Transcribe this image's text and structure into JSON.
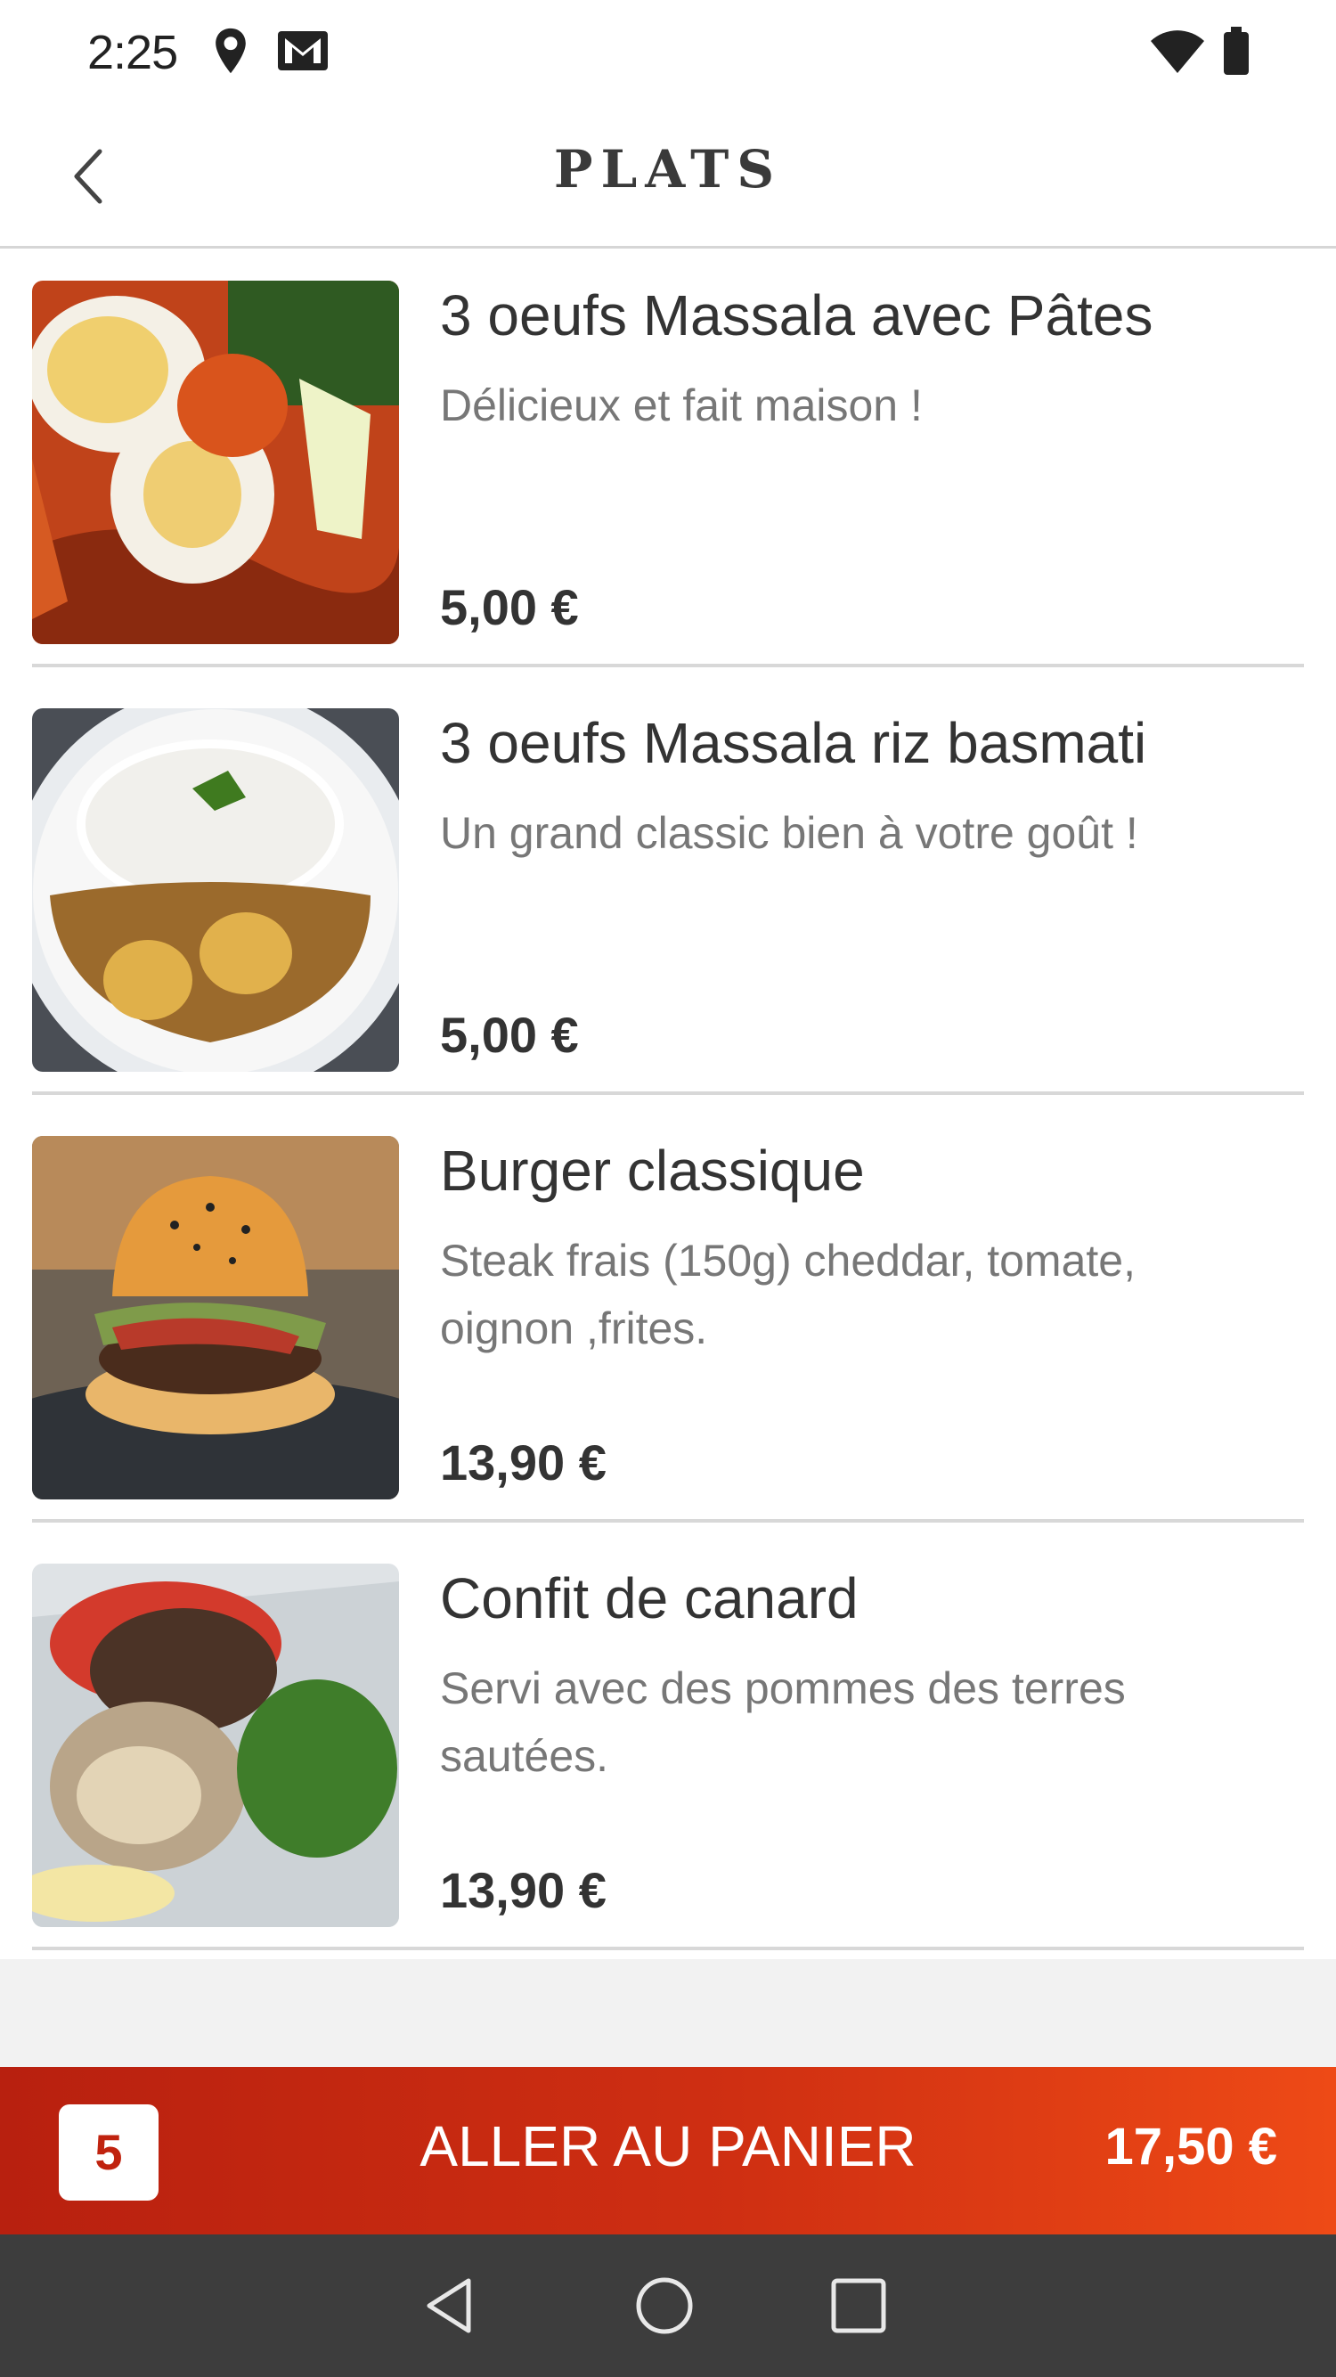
{
  "status_bar": {
    "time": "2:25",
    "left_icons": [
      "location-pin-icon",
      "gmail-icon"
    ],
    "right_icons": [
      "wifi-icon",
      "battery-icon"
    ]
  },
  "header": {
    "title": "PLATS",
    "back_icon": "back-chevron-icon"
  },
  "items": [
    {
      "name": "3 oeufs Massala avec Pâtes",
      "description": "Délicieux et fait maison !",
      "price": "5,00 €",
      "image": "photo of egg masala with pasta"
    },
    {
      "name": "3 oeufs Massala riz basmati",
      "description": "Un grand classic bien à votre goût !",
      "price": "5,00 €",
      "image": "photo of egg masala curry with rice"
    },
    {
      "name": "Burger classique",
      "description": "Steak frais (150g) cheddar, tomate, oignon ,frites.",
      "price": "13,90 €",
      "image": "photo of burger"
    },
    {
      "name": "Confit de canard",
      "description": "Servi avec des pommes des terres sautées.",
      "price": "13,90 €",
      "image": "photo of duck confit with salad"
    }
  ],
  "cart": {
    "count": "5",
    "label": "ALLER AU PANIER",
    "total": "17,50 €"
  },
  "nav_bar": {
    "buttons": [
      "back-triangle-icon",
      "home-circle-icon",
      "recents-square-icon"
    ]
  },
  "colors": {
    "cart_gradient_start": "#b8200f",
    "cart_gradient_end": "#ee4a16",
    "nav_bar": "#3d3d3d"
  }
}
